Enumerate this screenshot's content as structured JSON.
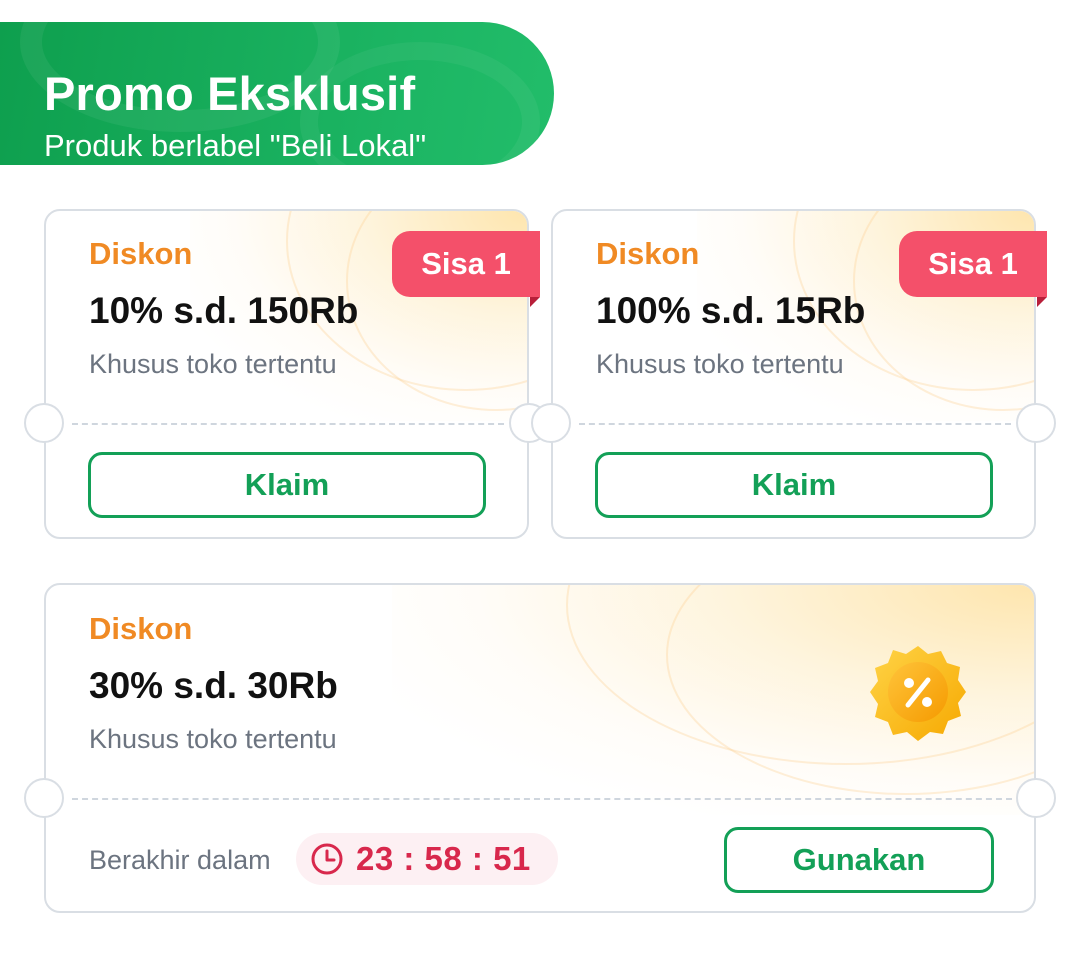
{
  "header": {
    "title": "Promo Eksklusif",
    "subtitle": "Produk berlabel \"Beli Lokal\""
  },
  "coupons": [
    {
      "label": "Diskon",
      "value": "10% s.d. 150Rb",
      "description": "Khusus toko tertentu",
      "stock_tag": "Sisa 1",
      "button": "Klaim"
    },
    {
      "label": "Diskon",
      "value": "100% s.d. 15Rb",
      "description": "Khusus toko tertentu",
      "stock_tag": "Sisa 1",
      "button": "Klaim"
    },
    {
      "label": "Diskon",
      "value": "30% s.d. 30Rb",
      "description": "Khusus toko tertentu",
      "expire_label": "Berakhir dalam",
      "countdown": "23 : 58 : 51",
      "button": "Gunakan",
      "badge_icon": "percent-badge-icon"
    }
  ],
  "colors": {
    "brand_green": "#13a057",
    "label_orange": "#f08a24",
    "tag_red": "#f4506a",
    "timer_red": "#d8284c"
  }
}
